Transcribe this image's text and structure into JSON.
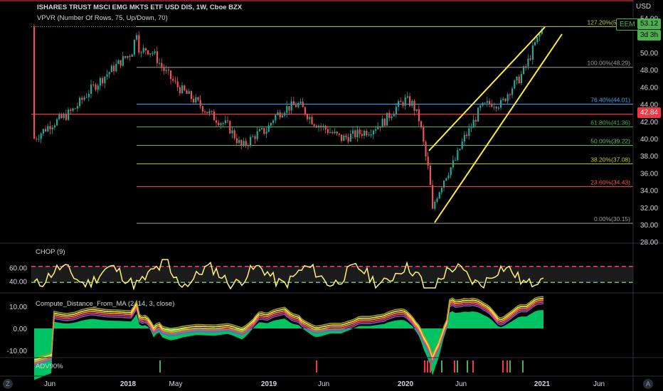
{
  "header": {
    "title": "ISHARES TRUST MSCI EMG MKTS ETF USD DIS, 1W, Cboe BZX",
    "indicator": "VPVR (Number Of Rows, 75, Up/Down, 70)"
  },
  "price_axis": {
    "currency": "USD",
    "ticks": [
      "54.00",
      "52.00",
      "50.00",
      "48.00",
      "46.00",
      "44.00",
      "42.00",
      "40.00",
      "38.00",
      "36.00",
      "34.00",
      "32.00",
      "30.00",
      "28.00"
    ],
    "symbol_tag": "EEM",
    "last_price": "53.12",
    "countdown": "3d 3h",
    "hline_price": "42.84"
  },
  "fib_levels": [
    {
      "label": "127.20%(53.03)",
      "price": 53.03,
      "color": "#c0ca33"
    },
    {
      "label": "100.00%(48.29)",
      "price": 48.29,
      "color": "#9e9e9e"
    },
    {
      "label": "76.40%(44.01)",
      "price": 44.01,
      "color": "#42a5f5"
    },
    {
      "label": "61.80%(41.36)",
      "price": 41.36,
      "color": "#4caf50"
    },
    {
      "label": "50.00%(39.22)",
      "price": 39.22,
      "color": "#66bb6a"
    },
    {
      "label": "38.20%(37.08)",
      "price": 37.08,
      "color": "#c0ca33"
    },
    {
      "label": "23.60%(34.43)",
      "price": 34.43,
      "color": "#ef5350"
    },
    {
      "label": "0.00%(30.15)",
      "price": 30.15,
      "color": "#9e9e9e"
    }
  ],
  "chop_panel": {
    "title": "CHOP (9)",
    "ticks": [
      "60.00",
      "40.00"
    ],
    "upper": 61.8,
    "lower": 38.2
  },
  "ma_panel": {
    "title": "Compute_Distance_From_MA (2, 14, 3, close)",
    "ticks": [
      "10.00",
      "0.00",
      "-10.00"
    ]
  },
  "adv_panel": {
    "title": "ADV90%"
  },
  "time_axis": [
    "Jun",
    "2018",
    "May",
    "2019",
    "Jun",
    "2020",
    "Jun",
    "2021",
    "Jun"
  ],
  "axis_buttons": {
    "left": "Z",
    "right": "A"
  },
  "colors": {
    "up": "#26a69a",
    "down": "#ef5350",
    "wedge": "#ffeb3b",
    "hline": "#f23645",
    "chop_line": "#fff176"
  }
}
